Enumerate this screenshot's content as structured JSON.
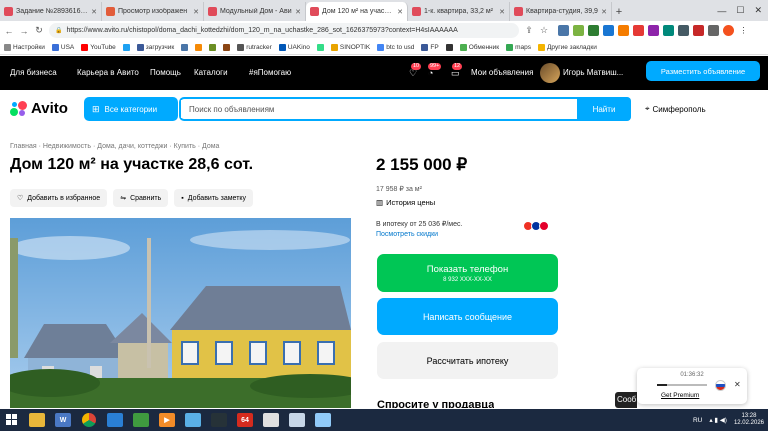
{
  "browser": {
    "tabs": [
      {
        "label": "Задание №2893616 - с",
        "color": "#e04b5a",
        "active": false
      },
      {
        "label": "Просмотр изображен",
        "color": "#e25c3a",
        "active": false
      },
      {
        "label": "Модульный Дом - Ави",
        "color": "#e04b5a",
        "active": false
      },
      {
        "label": "Дом 120 м² на участке",
        "color": "#e04b5a",
        "active": true
      },
      {
        "label": "1-к. квартира, 33,2 м²",
        "color": "#e04b5a",
        "active": false
      },
      {
        "label": "Квартира-студия, 39,9",
        "color": "#e04b5a",
        "active": false
      }
    ],
    "url": "https://www.avito.ru/chistopol/doma_dachi_kottedzhi/dom_120_m_na_uchastke_286_sot_1626375973?context=H4sIAAAAAA",
    "bookmarks": [
      "Настройки",
      "USA",
      "YouTube",
      "",
      "загрузчик",
      "",
      "",
      "",
      "",
      "rutracker",
      "UAKino",
      "",
      "SINOPTIK",
      "btc to usd",
      "FP",
      "",
      "Обменник",
      "maps",
      "Другие закладки"
    ],
    "bookmark_colors": [
      "#888",
      "#3a6fd8",
      "#ff0000",
      "#1da1f2",
      "#3b5998",
      "#4a76a8",
      "#f58a07",
      "#6b8e23",
      "#8b4513",
      "#555",
      "#0057b7",
      "#3d8",
      "#e9a400",
      "#4285f4",
      "#3b5998",
      "#333",
      "#4caf50",
      "#34a853",
      "#f4b400"
    ]
  },
  "topbar": {
    "links": [
      "Для бизнеса",
      "Карьера в Авито",
      "Помощь",
      "Каталоги",
      "#яПомогаю"
    ],
    "badges": [
      "10",
      "99+",
      "12"
    ],
    "my_ads": "Мои объявления",
    "user": "Игорь Матвиш...",
    "place_ad": "Разместить объявление"
  },
  "search": {
    "logo": "Avito",
    "categories": "Все категории",
    "placeholder": "Поиск по объявлениям",
    "find": "Найти",
    "city": "Симферополь"
  },
  "listing": {
    "breadcrumbs": "Главная · Недвижимость · Дома, дачи, коттеджи · Купить · Дома",
    "title": "Дом 120 м² на участке 28,6 сот.",
    "actions": [
      "Добавить в избранное",
      "Сравнить",
      "Добавить заметку"
    ],
    "price": "2 155 000 ₽",
    "price_per_m2": "17 958 ₽ за м²",
    "price_history": "История цены",
    "mortgage_text": "В ипотеку от 25 036 ₽/мес.",
    "mortgage_link": "Посмотреть скидки",
    "show_phone": "Показать телефон",
    "phone_masked": "8 932 XXX-XX-XX",
    "write_message": "Написать сообщение",
    "calc_mortgage": "Рассчитать ипотеку",
    "ask_seller": "Спросите у продавца"
  },
  "widget": {
    "time": "01:36:32",
    "premium": "Get Premium",
    "side_label": "Сооб",
    "progress": 0.2
  },
  "taskbar": {
    "lang": "RU",
    "time": "13:28",
    "date": "12.02.2026",
    "app_64": "64"
  },
  "icon_names": [
    "back-arrow-icon",
    "forward-arrow-icon",
    "reload-icon",
    "star-icon",
    "heart-icon",
    "compare-icon",
    "note-icon",
    "location-icon",
    "history-icon",
    "windows-start-icon"
  ]
}
